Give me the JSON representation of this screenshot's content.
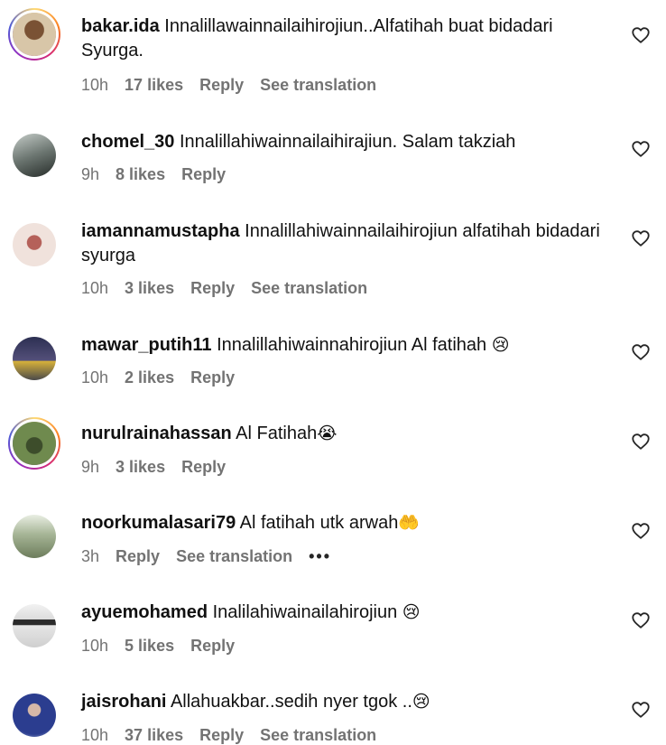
{
  "comments": [
    {
      "username": "bakar.ida",
      "text": "Innalillawainnailaihirojiun..Alfatihah buat bidadari Syurga.",
      "emoji": "",
      "time": "10h",
      "likes": "17 likes",
      "reply": "Reply",
      "translation": "See translation",
      "avatar_colors": [
        "#d8c6a8",
        "#5a3e2b"
      ]
    },
    {
      "username": "chomel_30",
      "text": "Innalillahiwainnailaihirajiun. Salam takziah",
      "emoji": "",
      "time": "9h",
      "likes": "8 likes",
      "reply": "Reply",
      "avatar_colors": [
        "#9aa3a0",
        "#2d3532"
      ]
    },
    {
      "username": "iamannamustapha",
      "text": "Innalillahiwainnailaihirojiun alfatihah bidadari syurga",
      "emoji": "",
      "time": "10h",
      "likes": "3 likes",
      "reply": "Reply",
      "translation": "See translation",
      "avatar_colors": [
        "#f0e2dc",
        "#c98d84"
      ]
    },
    {
      "username": "mawar_putih11",
      "text": "Innalillahiwainnahirojiun Al fatihah",
      "emoji": "😢",
      "time": "10h",
      "likes": "2 likes",
      "reply": "Reply",
      "avatar_colors": [
        "#3b3f63",
        "#d8b23a"
      ]
    },
    {
      "username": "nurulrainahassan",
      "text": "Al Fatihah",
      "emoji": "😭",
      "time": "9h",
      "likes": "3 likes",
      "reply": "Reply",
      "avatar_colors": [
        "#6f8a4e",
        "#3d4d2b"
      ]
    },
    {
      "username": "noorkumalasari79",
      "text": "Al fatihah utk arwah",
      "emoji": "🤲",
      "time": "3h",
      "reply": "Reply",
      "translation": "See translation",
      "more": "•••",
      "avatar_colors": [
        "#8da17d",
        "#e9eee3"
      ]
    },
    {
      "username": "ayuemohamed",
      "text": "Inalilahiwainailahirojiun",
      "emoji": "😢",
      "time": "10h",
      "likes": "5 likes",
      "reply": "Reply",
      "avatar_colors": [
        "#e6e6e6",
        "#2a2a2a"
      ]
    },
    {
      "username": "jaisrohani",
      "text": "Allahuakbar..sedih nyer tgok ..",
      "emoji": "😢",
      "time": "10h",
      "likes": "37 likes",
      "reply": "Reply",
      "translation": "See translation",
      "avatar_colors": [
        "#2b3d8f",
        "#d6b8a8"
      ]
    }
  ]
}
